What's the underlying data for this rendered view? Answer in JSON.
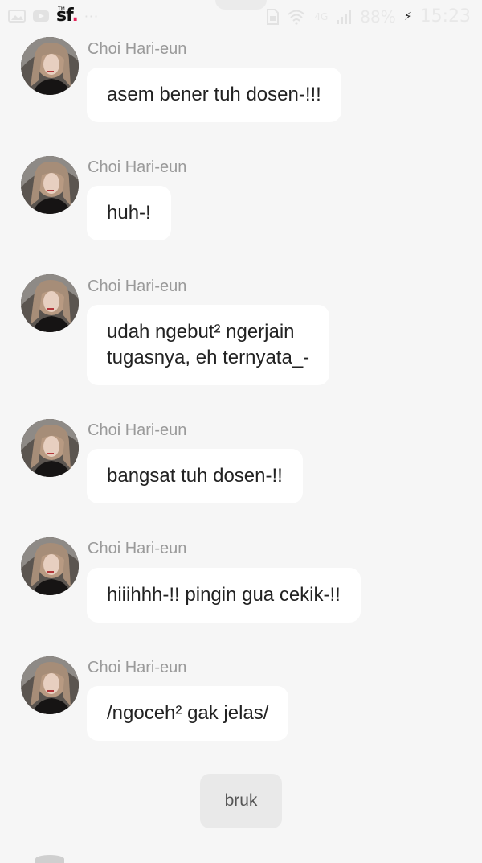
{
  "status_bar": {
    "logo_main": "sf",
    "logo_dot": ".",
    "logo_tm": "TM",
    "dots": "···",
    "signal_text": "4G",
    "battery_percent": "88%",
    "time": "15:23",
    "icons": [
      "image-icon",
      "youtube-icon",
      "sim-icon",
      "wifi-icon",
      "signal-icon",
      "charging-icon"
    ]
  },
  "chat": {
    "messages": [
      {
        "sender": "Choi Hari-eun",
        "text": "asem bener tuh dosen-!!!"
      },
      {
        "sender": "Choi Hari-eun",
        "text": "huh-!"
      },
      {
        "sender": "Choi Hari-eun",
        "text_line1": "udah ngebut² ngerjain",
        "text_line2": "tugasnya, eh ternyata_-"
      },
      {
        "sender": "Choi Hari-eun",
        "text": "bangsat tuh dosen-!!"
      },
      {
        "sender": "Choi Hari-eun",
        "text": "hiiihhh-!! pingin gua cekik-!!"
      },
      {
        "sender": "Choi Hari-eun",
        "text": "/ngoceh² gak jelas/"
      }
    ],
    "narration": "bruk"
  },
  "colors": {
    "background": "#f6f6f6",
    "bubble": "#ffffff",
    "sender_name": "#9a9a9a",
    "narration_bg": "#e9e9e9",
    "logo_accent": "#e5245a"
  }
}
